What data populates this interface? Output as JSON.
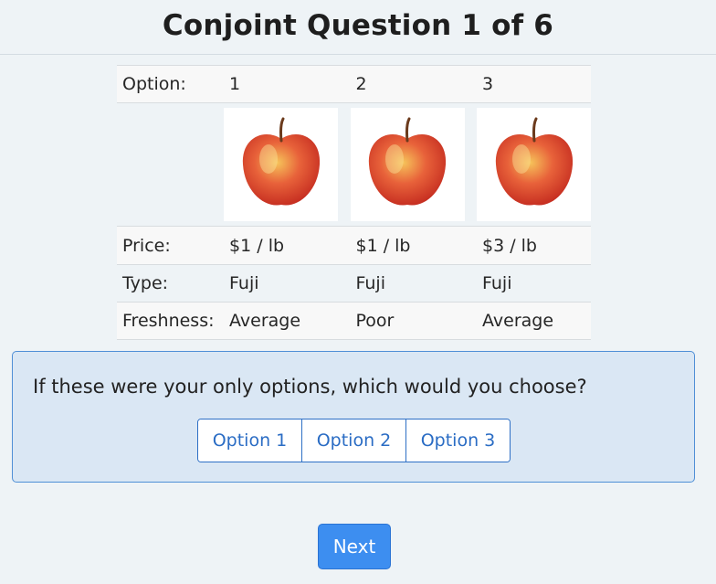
{
  "header": {
    "title": "Conjoint Question 1 of 6"
  },
  "table": {
    "header_label": "Option:",
    "options": [
      "1",
      "2",
      "3"
    ],
    "images": [
      {
        "icon": "apple-image",
        "alt": "apple"
      },
      {
        "icon": "apple-image",
        "alt": "apple"
      },
      {
        "icon": "apple-image",
        "alt": "apple"
      }
    ],
    "rows": [
      {
        "label": "Price:",
        "values": [
          "$1 / lb",
          "$1 / lb",
          "$3 / lb"
        ]
      },
      {
        "label": "Type:",
        "values": [
          "Fuji",
          "Fuji",
          "Fuji"
        ]
      },
      {
        "label": "Freshness:",
        "values": [
          "Average",
          "Poor",
          "Average"
        ]
      }
    ]
  },
  "question": {
    "text": "If these were your only options, which would you choose?",
    "choices": [
      "Option 1",
      "Option 2",
      "Option 3"
    ]
  },
  "footer": {
    "next_label": "Next"
  },
  "colors": {
    "accent": "#3d8ef0",
    "panel_bg": "#dae7f4",
    "panel_border": "#4f8fd6",
    "page_bg": "#eef3f6"
  }
}
